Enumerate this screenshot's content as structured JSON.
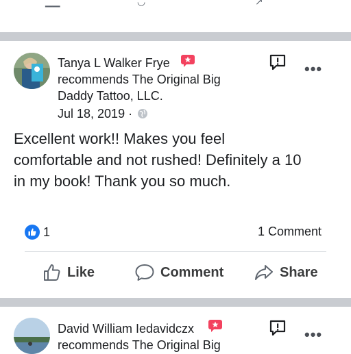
{
  "post1": {
    "author": "Tanya L Walker Frye",
    "recommends_line1": "recommends The Original Big",
    "recommends_line2": "Daddy Tattoo, LLC.",
    "date": "Jul 18, 2019 ·",
    "text_line1": "Excellent work!! Makes you feel",
    "text_line2": "comfortable and not rushed! Definitely a 10",
    "text_line3": "in my book! Thank you so much.",
    "reactions_count": "1",
    "comments_count": "1 Comment",
    "actions": {
      "like": "Like",
      "comment": "Comment",
      "share": "Share"
    }
  },
  "post2": {
    "author": "David William Iedavidczx",
    "recommends_line1": "recommends The Original Big"
  },
  "icons": {
    "recommend": "recommend-badge-icon",
    "report": "report-flag-icon",
    "more": "more-options-icon",
    "globe": "globe-icon",
    "like_reaction": "like-reaction-icon"
  },
  "colors": {
    "recommend_red": "#f3425f",
    "like_blue": "#1877f2",
    "divider_gray": "#c9ccd1"
  }
}
